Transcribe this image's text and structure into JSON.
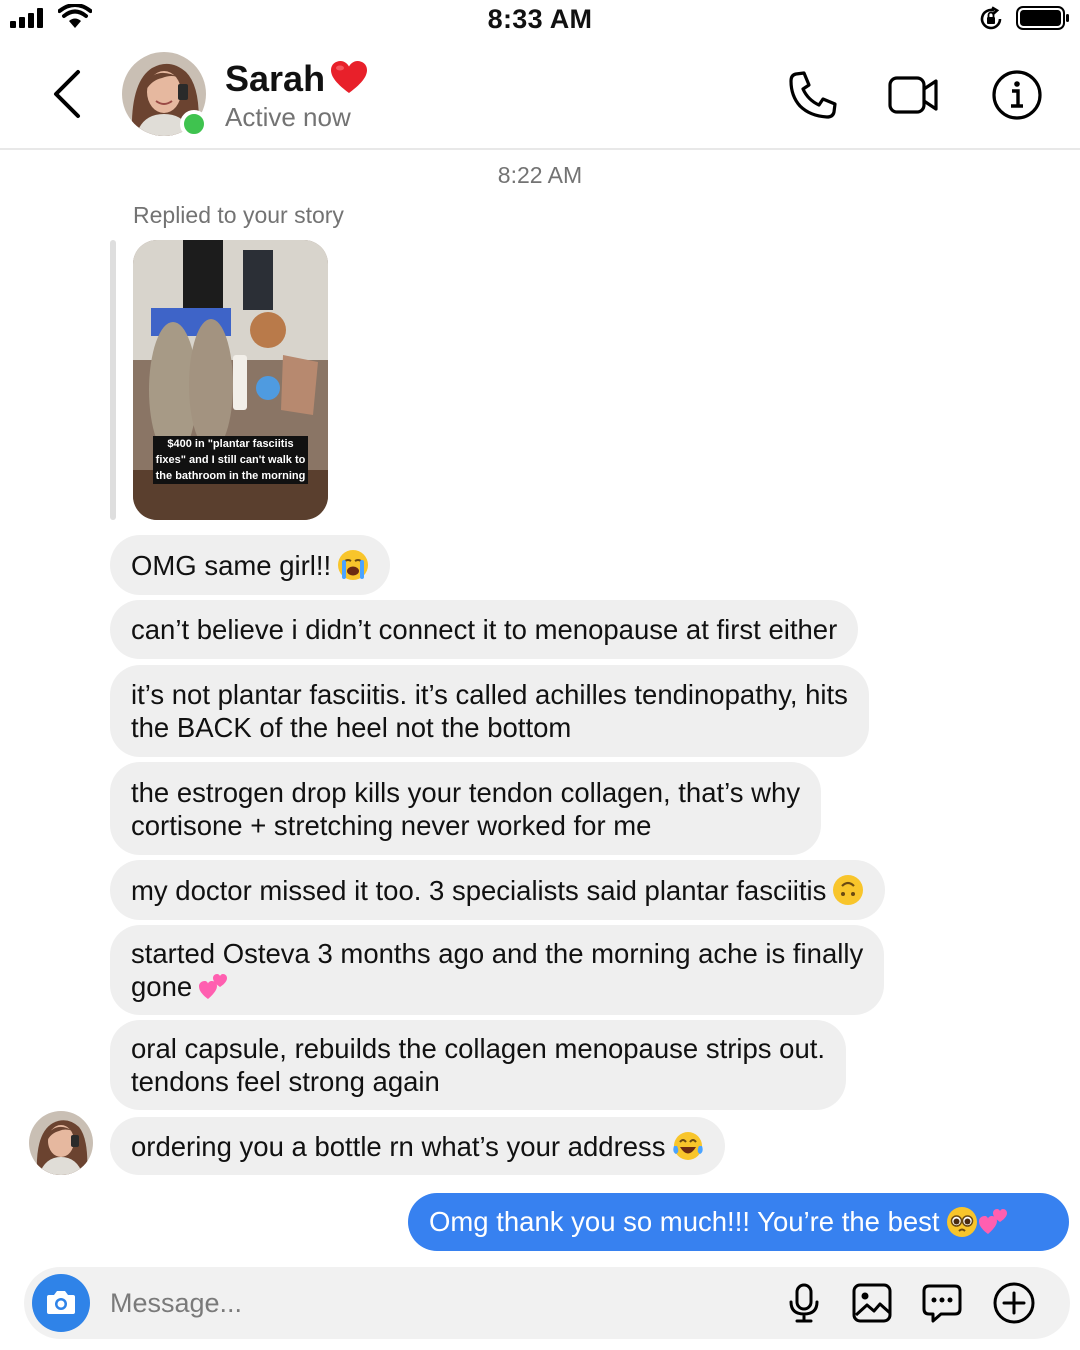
{
  "status_bar": {
    "time": "8:33 AM"
  },
  "header": {
    "contact_name": "Sarah",
    "status": "Active now",
    "icons": [
      "back-chevron-icon",
      "phone-icon",
      "video-camera-icon",
      "info-icon",
      "red-heart-emoji"
    ]
  },
  "chat": {
    "timestamp": "8:22 AM",
    "reply_label": "Replied to your story",
    "story_caption": "$400 in \"plantar fasciitis fixes\" and I still can't walk to the bathroom in the morning",
    "received": [
      {
        "text": "OMG same girl!!",
        "emoji": "loudly-crying-face"
      },
      {
        "text": "can’t believe i didn’t connect it to menopause at first either"
      },
      {
        "lines": [
          "it’s not plantar fasciitis. it’s called achilles tendinopathy, hits",
          "the BACK of the heel not the bottom"
        ]
      },
      {
        "lines": [
          "the estrogen drop kills your tendon collagen, that’s why",
          "cortisone + stretching never worked for me"
        ]
      },
      {
        "text": "my doctor missed it too. 3 specialists said plantar fasciitis",
        "emoji": "upside-down-face"
      },
      {
        "lines": [
          "started Osteva 3 months ago and the morning ache is finally",
          "gone"
        ],
        "emoji": "two-hearts"
      },
      {
        "lines": [
          "oral capsule, rebuilds the collagen menopause strips out.",
          "tendons feel strong again"
        ]
      },
      {
        "text": "ordering you a bottle rn what’s your address",
        "emoji": "tears-of-joy-face"
      }
    ],
    "sent": [
      {
        "text": "Omg thank you so much!!! You’re the best",
        "emoji": [
          "pleading-face",
          "two-hearts"
        ]
      }
    ]
  },
  "composer": {
    "placeholder": "Message...",
    "icons": [
      "camera-icon",
      "microphone-icon",
      "gallery-icon",
      "sticker-icon",
      "plus-icon"
    ]
  },
  "colors": {
    "sent_bubble": "#3781f0",
    "received_bubble": "#efefef",
    "online_indicator": "#3fc34f",
    "camera_button": "#2f83e8",
    "muted_text": "#737373"
  }
}
